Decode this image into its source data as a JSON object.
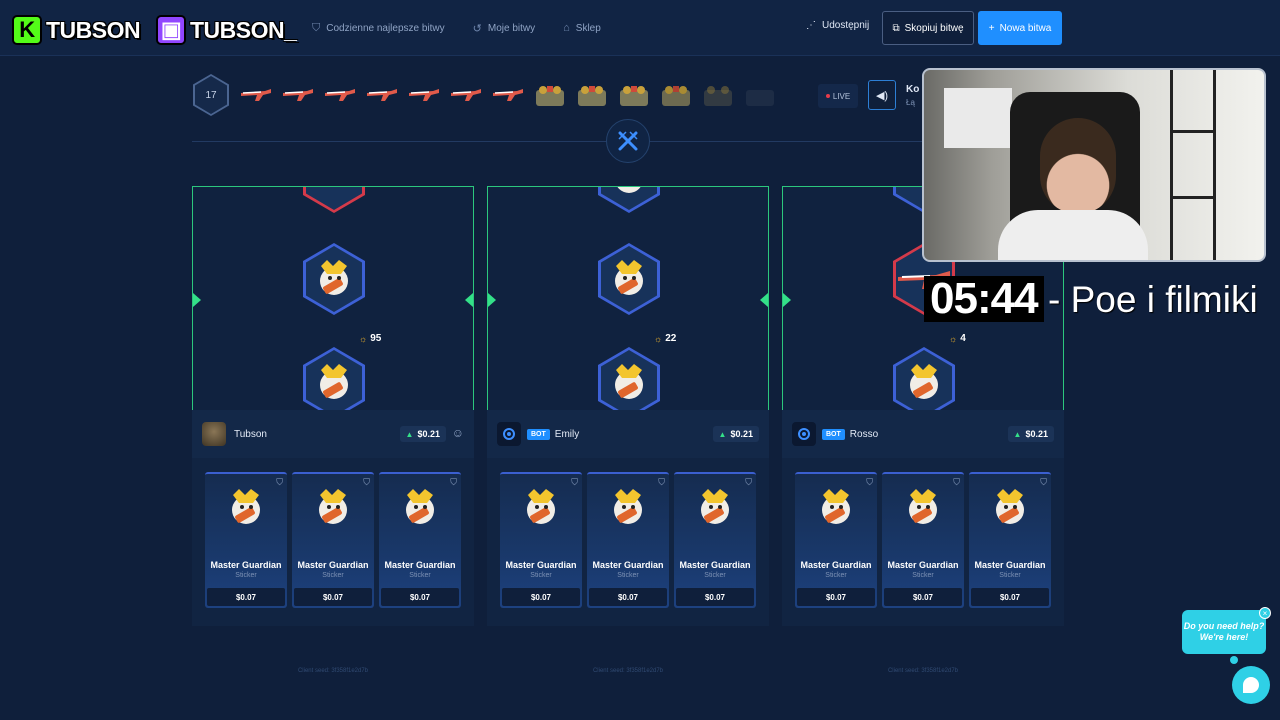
{
  "streamer": {
    "kick_name": "TUBSON",
    "twitch_name": "TUBSON_"
  },
  "nav": {
    "links": [
      {
        "label": "Codzienne najlepsze bitwy",
        "icon": "shield-icon"
      },
      {
        "label": "Moje bitwy",
        "icon": "history-icon"
      },
      {
        "label": "Sklep",
        "icon": "shop-icon"
      }
    ],
    "share_label": "Udostępnij",
    "copy_label": "Skopiuj bitwę",
    "new_label": "Nowa bitwa"
  },
  "battle": {
    "round": "17",
    "live_label": "LIVE",
    "sub_title": "Ko",
    "sub_caption": "Łą"
  },
  "players": [
    {
      "name": "Tubson",
      "is_bot": false,
      "total": "$0.21",
      "points": "95",
      "items": [
        {
          "name": "Master Guardian",
          "type": "Sticker",
          "price": "$0.07"
        },
        {
          "name": "Master Guardian",
          "type": "Sticker",
          "price": "$0.07"
        },
        {
          "name": "Master Guardian",
          "type": "Sticker",
          "price": "$0.07"
        }
      ],
      "seed": "Client seed: 3f358f1e2d7b"
    },
    {
      "name": "Emily",
      "is_bot": true,
      "bot_label": "BOT",
      "total": "$0.21",
      "points": "22",
      "items": [
        {
          "name": "Master Guardian",
          "type": "Sticker",
          "price": "$0.07"
        },
        {
          "name": "Master Guardian",
          "type": "Sticker",
          "price": "$0.07"
        },
        {
          "name": "Master Guardian",
          "type": "Sticker",
          "price": "$0.07"
        }
      ],
      "seed": "Client seed: 3f358f1e2d7b"
    },
    {
      "name": "Rosso",
      "is_bot": true,
      "bot_label": "BOT",
      "total": "$0.21",
      "points": "4",
      "items": [
        {
          "name": "Master Guardian",
          "type": "Sticker",
          "price": "$0.07"
        },
        {
          "name": "Master Guardian",
          "type": "Sticker",
          "price": "$0.07"
        },
        {
          "name": "Master Guardian",
          "type": "Sticker",
          "price": "$0.07"
        }
      ],
      "seed": "Client seed: 3f358f1e2d7b"
    }
  ],
  "overlay": {
    "timer": "05:44",
    "subtitle": "- Poe i filmiki"
  },
  "help": {
    "line1": "Do you need help?",
    "line2": "We're here!",
    "close": "×"
  },
  "colors": {
    "background": "#0f1f3b",
    "accent": "#1f8fff",
    "win_border": "#2cc77d",
    "help": "#2fd0e6"
  }
}
